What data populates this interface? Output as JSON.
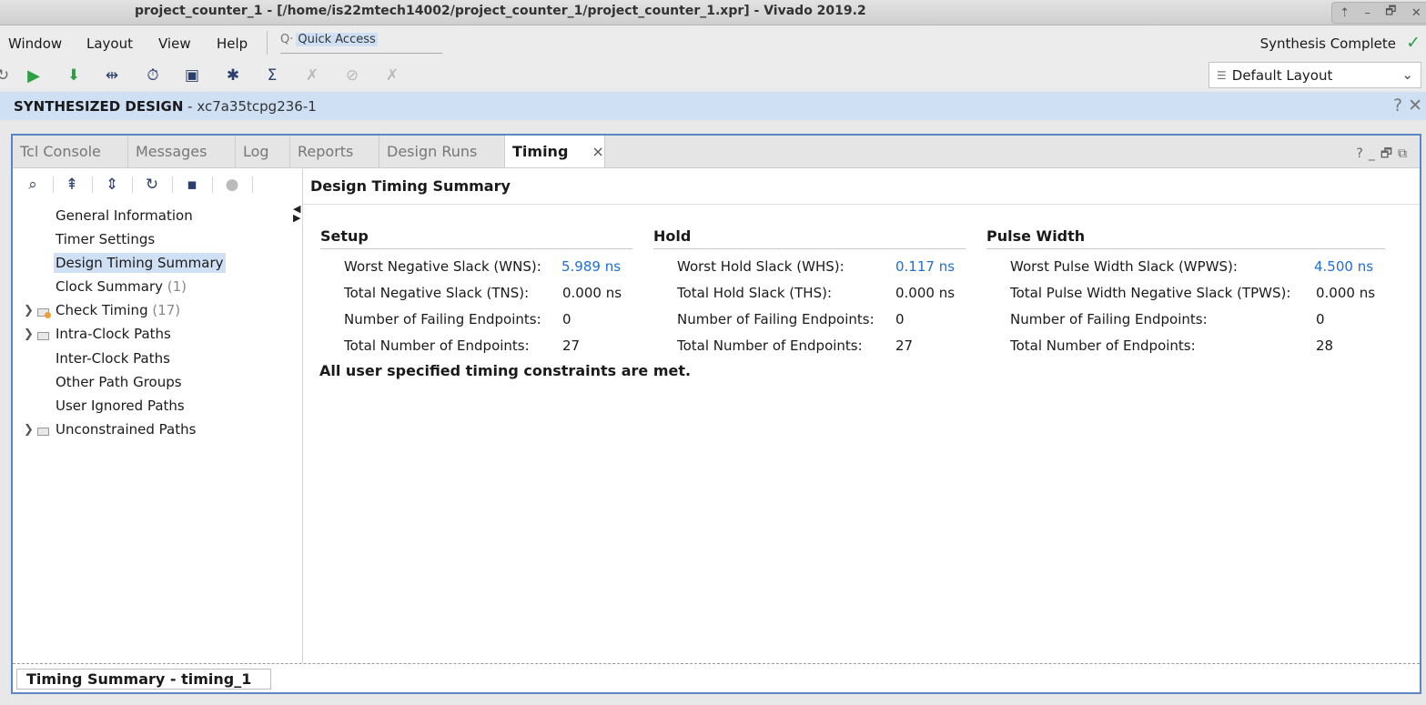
{
  "window": {
    "title": "project_counter_1 - [/home/is22mtech14002/project_counter_1/project_counter_1.xpr] - Vivado 2019.2",
    "controls": [
      "⇡",
      "–",
      "🗗",
      "✕"
    ]
  },
  "menu": {
    "items": [
      {
        "label": "Window"
      },
      {
        "label": "Layout"
      },
      {
        "label": "View"
      },
      {
        "label": "Help"
      }
    ],
    "quick_access": "Quick Access",
    "status": "Synthesis Complete",
    "status_icon": "checkmark-icon"
  },
  "toolbar": {
    "layout_select": "Default Layout"
  },
  "design_bar": {
    "title": "SYNTHESIZED DESIGN",
    "part": " - xc7a35tcpg236-1",
    "help": "?",
    "close": "✕"
  },
  "tabs": [
    {
      "label": "Tcl Console"
    },
    {
      "label": "Messages"
    },
    {
      "label": "Log"
    },
    {
      "label": "Reports"
    },
    {
      "label": "Design Runs"
    },
    {
      "label": "Timing",
      "active": true
    }
  ],
  "tab_close": "×",
  "nav": {
    "items": [
      {
        "label": "General Information"
      },
      {
        "label": "Timer Settings"
      },
      {
        "label": "Design Timing Summary",
        "selected": true
      },
      {
        "label": "Clock Summary",
        "count": " (1)"
      },
      {
        "label": "Check Timing",
        "count": " (17)"
      },
      {
        "label": "Intra-Clock Paths"
      },
      {
        "label": "Inter-Clock Paths"
      },
      {
        "label": "Other Path Groups"
      },
      {
        "label": "User Ignored Paths"
      },
      {
        "label": "Unconstrained Paths"
      }
    ]
  },
  "main": {
    "title": "Design Timing Summary",
    "setup": {
      "heading": "Setup",
      "rows": [
        {
          "label": "Worst Negative Slack (WNS):",
          "value": "5.989 ns"
        },
        {
          "label": "Total Negative Slack (TNS):",
          "value": "0.000 ns"
        },
        {
          "label": "Number of Failing Endpoints:",
          "value": "0"
        },
        {
          "label": "Total Number of Endpoints:",
          "value": "27"
        }
      ]
    },
    "hold": {
      "heading": "Hold",
      "rows": [
        {
          "label": "Worst Hold Slack (WHS):",
          "value": "0.117 ns"
        },
        {
          "label": "Total Hold Slack (THS):",
          "value": "0.000 ns"
        },
        {
          "label": "Number of Failing Endpoints:",
          "value": "0"
        },
        {
          "label": "Total Number of Endpoints:",
          "value": "27"
        }
      ]
    },
    "pulse": {
      "heading": "Pulse Width",
      "rows": [
        {
          "label": "Worst Pulse Width Slack (WPWS):",
          "value": "4.500 ns"
        },
        {
          "label": "Total Pulse Width Negative Slack (TPWS):",
          "value": "0.000 ns"
        },
        {
          "label": "Number of Failing Endpoints:",
          "value": "0"
        },
        {
          "label": "Total Number of Endpoints:",
          "value": "28"
        }
      ]
    },
    "message": "All user specified timing constraints are met."
  },
  "bottom_tab": "Timing Summary - timing_1",
  "colors": {
    "accent": "#5a86c8",
    "selection": "#cfe0f5",
    "link": "#1f6fd6",
    "success": "#2ea043"
  }
}
